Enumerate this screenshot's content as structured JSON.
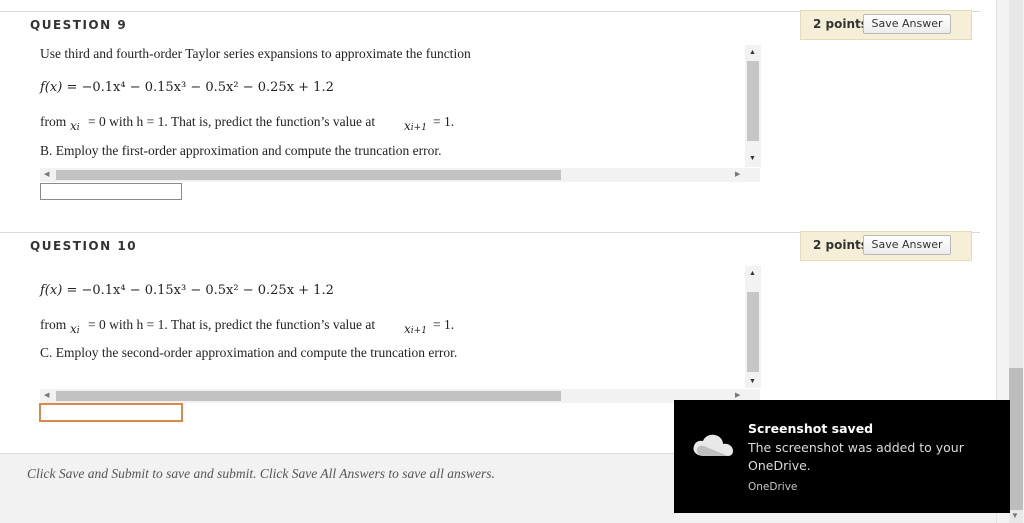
{
  "questions": [
    {
      "title": "QUESTION 9",
      "points": "2 points",
      "save_label": "Save Answer",
      "intro": "Use third and fourth-order Taylor series expansions to approximate the function",
      "function": {
        "fx": "f(x)",
        "rhs": "= −0.1x⁴ − 0.15x³ − 0.5x² − 0.25x + 1.2"
      },
      "from_line": {
        "from": "from",
        "xi": "x",
        "xi_sub": "i",
        "middle": "= 0 with h = 1. That is, predict the function’s value at",
        "xi1": "x",
        "xi1_sub": "i+1",
        "end": "= 1."
      },
      "part": "B. Employ the first-order approximation and compute the truncation error."
    },
    {
      "title": "QUESTION 10",
      "points": "2 points",
      "save_label": "Save Answer",
      "function": {
        "fx": "f(x)",
        "rhs": "= −0.1x⁴ − 0.15x³ − 0.5x² − 0.25x + 1.2"
      },
      "from_line": {
        "from": "from",
        "xi": "x",
        "xi_sub": "i",
        "middle": "= 0 with h = 1. That is, predict the function’s value at",
        "xi1": "x",
        "xi1_sub": "i+1",
        "end": "= 1."
      },
      "part": "C. Employ the second-order approximation and compute the truncation error."
    }
  ],
  "footer": {
    "text": "Click Save and Submit to save and submit. Click Save All Answers to save all answers."
  },
  "toast": {
    "title": "Screenshot saved",
    "body": "The screenshot was added to your OneDrive.",
    "app": "OneDrive",
    "icon": "onedrive-cloud-icon",
    "bg_color": "#000000"
  }
}
